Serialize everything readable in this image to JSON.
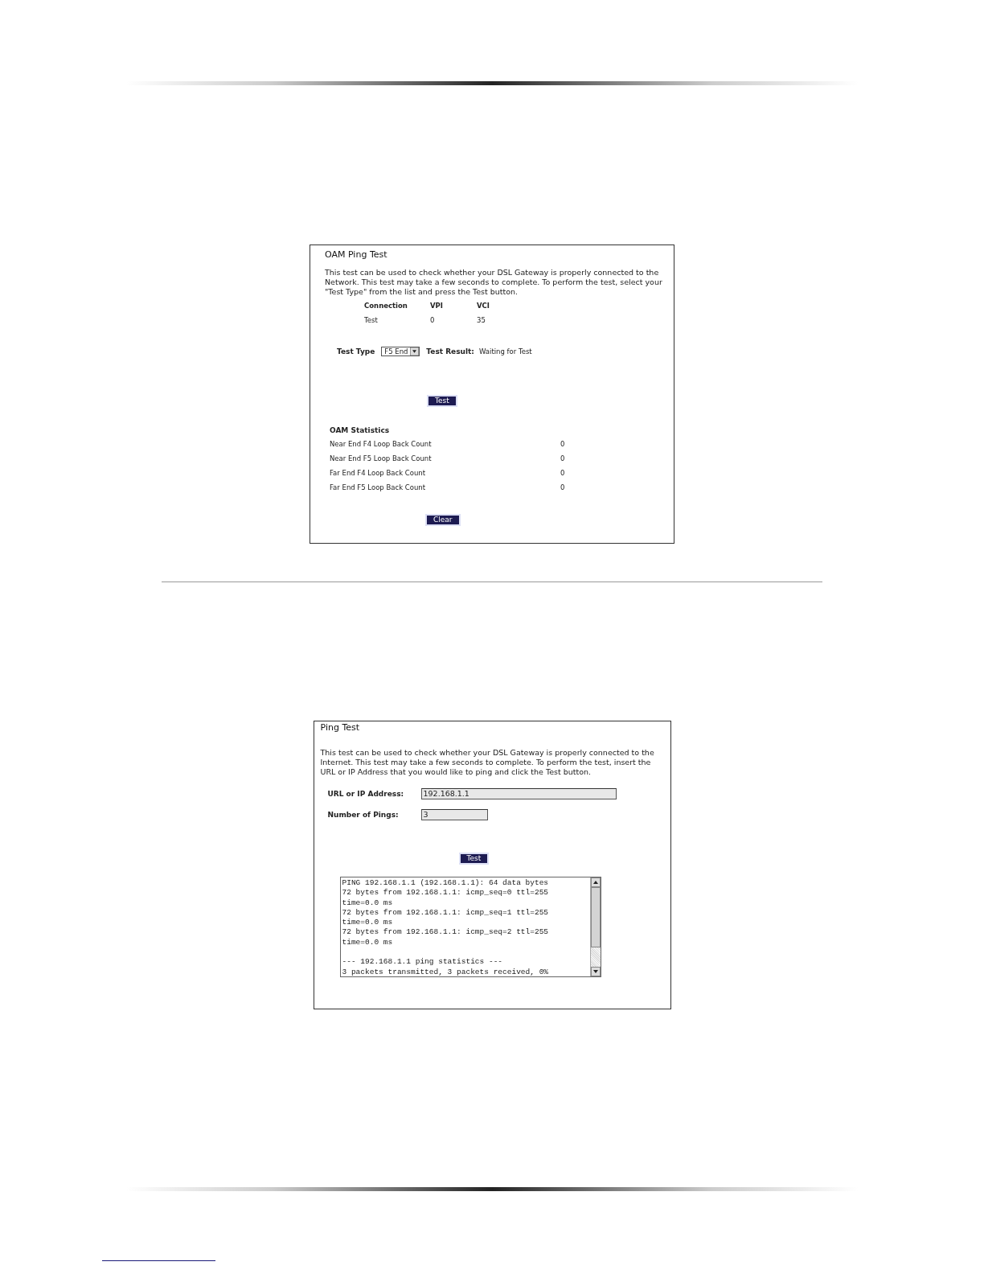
{
  "oam_ping_test": {
    "title": "OAM Ping Test",
    "description": "This test can be used to check whether your DSL Gateway is properly connected to the Network. This test may take a few seconds to complete. To perform the test, select your \"Test Type\" from the list and press the Test button.",
    "connection_table": {
      "columns": [
        "Connection",
        "VPI",
        "VCI"
      ],
      "rows": [
        [
          "Test",
          "0",
          "35"
        ]
      ]
    },
    "test_type": {
      "label": "Test Type",
      "value": "F5 End"
    },
    "test_result": {
      "label": "Test Result:",
      "value": "Waiting for Test"
    },
    "test_button": "Test",
    "statistics_title": "OAM Statistics",
    "statistics": [
      {
        "label": "Near End F4 Loop Back Count",
        "value": "0"
      },
      {
        "label": "Near End F5 Loop Back Count",
        "value": "0"
      },
      {
        "label": "Far End F4 Loop Back Count",
        "value": "0"
      },
      {
        "label": "Far End F5 Loop Back Count",
        "value": "0"
      }
    ],
    "clear_button": "Clear"
  },
  "ping_test": {
    "title": "Ping Test",
    "description": "This test can be used to check whether your DSL Gateway is properly connected to the Internet. This test may take a few seconds to complete. To perform the test, insert the URL or IP Address that you would like to ping and click the Test button.",
    "fields": [
      {
        "label": "URL or IP Address:",
        "value": "192.168.1.1"
      },
      {
        "label": "Number of Pings:",
        "value": "3"
      }
    ],
    "test_button": "Test",
    "output": [
      [
        "PING 192.168.1.1 (192.168.1.1): 64 data bytes",
        "72 bytes from 192.168.1.1: icmp_seq=0 ttl=255",
        "time=0.0 ms",
        "72 bytes from 192.168.1.1: icmp_seq=1 ttl=255",
        "time=0.0 ms",
        "72 bytes from 192.168.1.1: icmp_seq=2 ttl=255",
        "time=0.0 ms"
      ],
      [
        "--- 192.168.1.1 ping statistics ---",
        "3 packets transmitted, 3 packets received, 0%"
      ]
    ]
  }
}
